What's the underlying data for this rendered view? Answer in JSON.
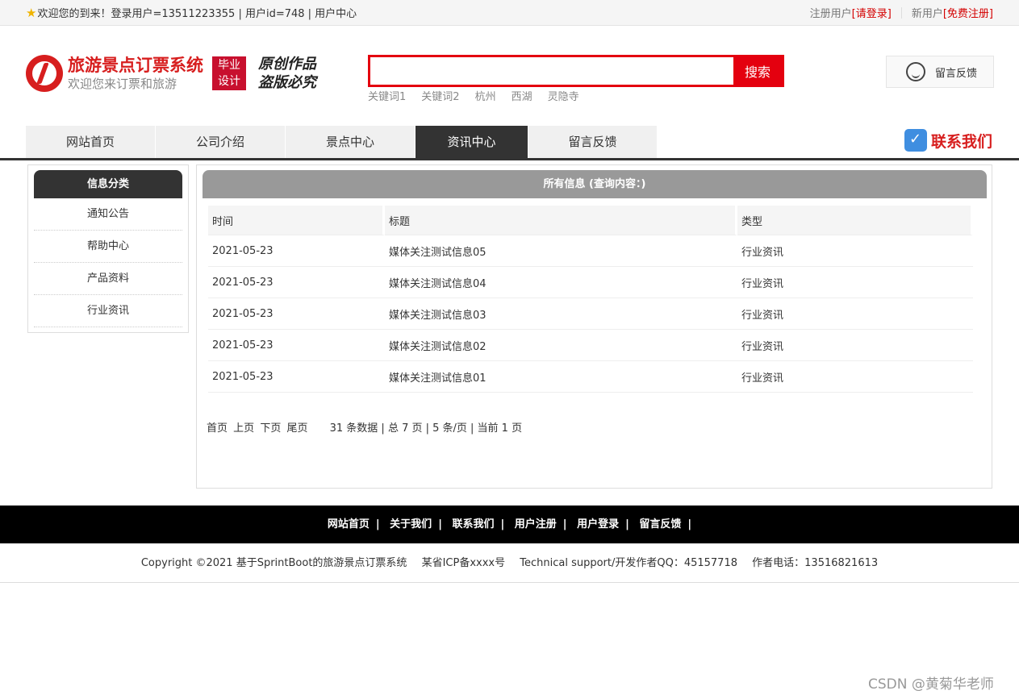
{
  "topbar": {
    "welcome": "欢迎您的到来！登录用户=13511223355 | 用户id=748 | 用户中心",
    "register_user": "注册用户",
    "login_link": "[请登录]",
    "new_user": "新用户",
    "free_register": "[免费注册]"
  },
  "header": {
    "logo_title": "旅游景点订票系统",
    "logo_sub": "欢迎您来订票和旅游",
    "badge_line1": "毕业",
    "badge_line2": "设计",
    "slogan_line1": "原创作品",
    "slogan_line2": "盗版必究",
    "search_button": "搜索",
    "search_value": "",
    "keywords": [
      "关键词1",
      "关键词2",
      "杭州",
      "西湖",
      "灵隐寺"
    ],
    "feedback": "留言反馈"
  },
  "nav": {
    "items": [
      "网站首页",
      "公司介绍",
      "景点中心",
      "资讯中心",
      "留言反馈"
    ],
    "active": "资讯中心",
    "contact": "联系我们"
  },
  "sidebar": {
    "title": "信息分类",
    "items": [
      "通知公告",
      "帮助中心",
      "产品资料",
      "行业资讯"
    ]
  },
  "main": {
    "title": "所有信息 (查询内容：)",
    "columns": [
      "时间",
      "标题",
      "类型"
    ],
    "rows": [
      [
        "2021-05-23",
        "媒体关注测试信息05",
        "行业资讯"
      ],
      [
        "2021-05-23",
        "媒体关注测试信息04",
        "行业资讯"
      ],
      [
        "2021-05-23",
        "媒体关注测试信息03",
        "行业资讯"
      ],
      [
        "2021-05-23",
        "媒体关注测试信息02",
        "行业资讯"
      ],
      [
        "2021-05-23",
        "媒体关注测试信息01",
        "行业资讯"
      ]
    ],
    "pager": {
      "first": "首页",
      "prev": "上页",
      "next": "下页",
      "last": "尾页",
      "info": "31 条数据 | 总 7 页 | 5 条/页 | 当前 1 页"
    }
  },
  "footer": {
    "links": [
      "网站首页",
      "关于我们",
      "联系我们",
      "用户注册",
      "用户登录",
      "留言反馈"
    ],
    "copyright": "Copyright ©2021 基于SprintBoot的旅游景点订票系统",
    "icp": "某省ICP备xxxx号",
    "support": "Technical support/开发作者QQ：45157718",
    "phone": "作者电话：13516821613"
  },
  "watermark": "CSDN @黄菊华老师",
  "colors": {
    "brand_red": "#d71e1e",
    "search_red": "#e4000f",
    "nav_dark": "#333333"
  },
  "icons": {
    "star": "star-icon",
    "logo": "logo-icon",
    "feedback": "headset-icon",
    "contact": "phone-check-icon"
  }
}
